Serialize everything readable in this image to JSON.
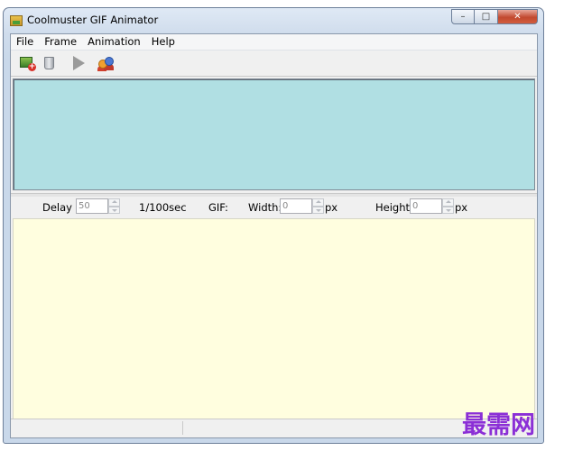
{
  "window": {
    "title": "Coolmuster GIF Animator",
    "caption_minimize": "–",
    "caption_maximize": "□",
    "caption_close": "✕"
  },
  "menu": {
    "items": [
      {
        "label": "File"
      },
      {
        "label": "Frame"
      },
      {
        "label": "Animation"
      },
      {
        "label": "Help"
      }
    ]
  },
  "toolbar": {
    "buttons": [
      {
        "icon": "add-image-icon"
      },
      {
        "icon": "delete-icon"
      },
      {
        "icon": "play-icon"
      },
      {
        "icon": "users-icon"
      }
    ]
  },
  "settings": {
    "delay_label": "Delay :",
    "delay_value": "50",
    "delay_unit": "1/100sec",
    "gif_label": "GIF:",
    "width_label": "Width:",
    "width_value": "0",
    "width_unit": "px",
    "height_label": "Height:",
    "height_value": "0",
    "height_unit": "px"
  },
  "status": {
    "pane1": "",
    "pane2": ""
  },
  "watermark": "最需网",
  "colors": {
    "frames_panel_bg": "#b0dfe3",
    "preview_bg": "#fffedf",
    "watermark": "#8b2fd6"
  }
}
